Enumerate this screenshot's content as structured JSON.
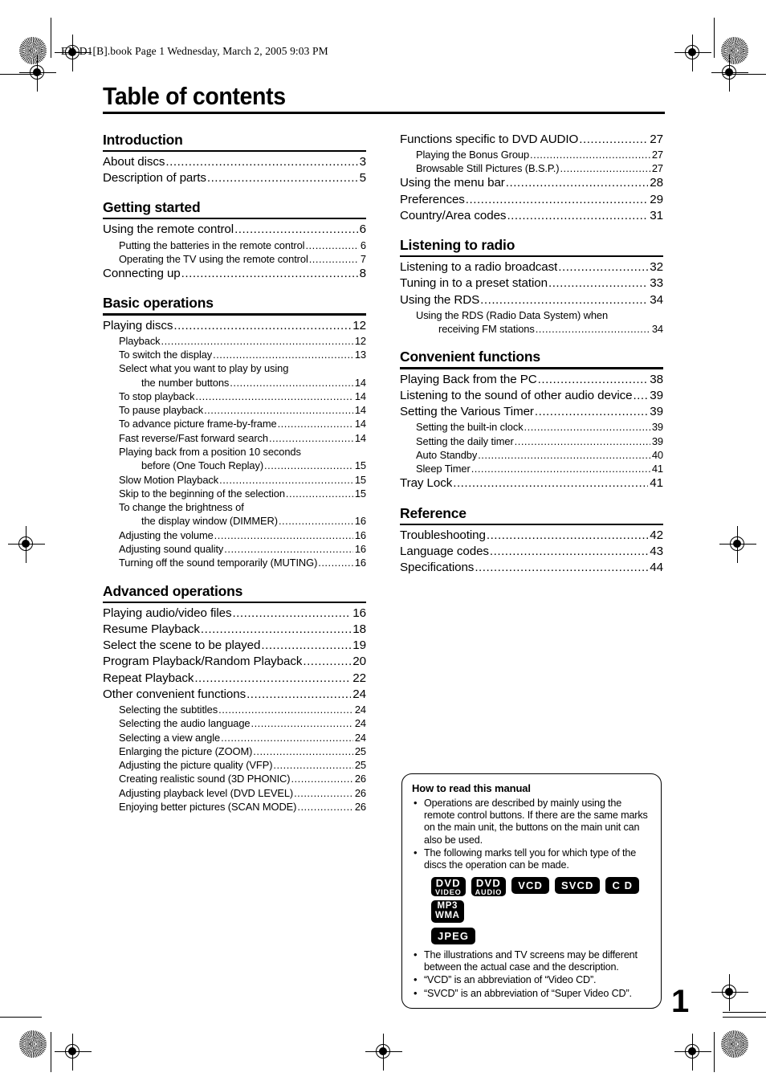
{
  "file_header": "EX-D1[B].book  Page 1  Wednesday, March 2, 2005  9:03 PM",
  "page_title": "Table of contents",
  "page_number": "1",
  "left_column": [
    {
      "heading": "Introduction",
      "entries": [
        {
          "level": 0,
          "text": "About discs",
          "page": "3"
        },
        {
          "level": 0,
          "text": "Description of parts",
          "page": "5"
        }
      ]
    },
    {
      "heading": "Getting started",
      "entries": [
        {
          "level": 0,
          "text": "Using the remote control",
          "page": "6"
        },
        {
          "level": 1,
          "text": "Putting the batteries in the remote control",
          "page": "6"
        },
        {
          "level": 1,
          "text": "Operating the TV using the remote control",
          "page": "7"
        },
        {
          "level": 0,
          "text": "Connecting up",
          "page": "8"
        }
      ]
    },
    {
      "heading": "Basic operations",
      "entries": [
        {
          "level": 0,
          "text": "Playing discs",
          "page": "12"
        },
        {
          "level": 1,
          "text": "Playback",
          "page": "12"
        },
        {
          "level": 1,
          "text": "To switch the display",
          "page": "13"
        },
        {
          "level": 1,
          "text": "Select what you want to play by using",
          "page": "",
          "cont": true
        },
        {
          "level": 2,
          "text": "the number buttons",
          "page": "14"
        },
        {
          "level": 1,
          "text": "To stop playback",
          "page": "14"
        },
        {
          "level": 1,
          "text": "To pause playback",
          "page": "14"
        },
        {
          "level": 1,
          "text": "To advance picture frame-by-frame",
          "page": "14"
        },
        {
          "level": 1,
          "text": "Fast reverse/Fast forward search",
          "page": "14"
        },
        {
          "level": 1,
          "text": "Playing back from a position 10 seconds",
          "page": "",
          "cont": true
        },
        {
          "level": 2,
          "text": "before (One Touch Replay)",
          "page": "15"
        },
        {
          "level": 1,
          "text": "Slow Motion Playback",
          "page": "15"
        },
        {
          "level": 1,
          "text": "Skip to the beginning of the selection",
          "page": "15"
        },
        {
          "level": 1,
          "text": "To change the brightness of",
          "page": "",
          "cont": true
        },
        {
          "level": 2,
          "text": "the display window (DIMMER)",
          "page": "16"
        },
        {
          "level": 1,
          "text": "Adjusting the volume",
          "page": "16"
        },
        {
          "level": 1,
          "text": "Adjusting sound quality",
          "page": "16"
        },
        {
          "level": 1,
          "text": "Turning off the sound temporarily (MUTING)",
          "page": "16"
        }
      ]
    },
    {
      "heading": "Advanced operations",
      "entries": [
        {
          "level": 0,
          "text": "Playing audio/video files",
          "page": "16"
        },
        {
          "level": 0,
          "text": "Resume Playback",
          "page": "18"
        },
        {
          "level": 0,
          "text": "Select the scene to be played",
          "page": "19"
        },
        {
          "level": 0,
          "text": "Program Playback/Random Playback",
          "page": "20"
        },
        {
          "level": 0,
          "text": "Repeat Playback",
          "page": "22"
        },
        {
          "level": 0,
          "text": "Other convenient functions",
          "page": "24"
        },
        {
          "level": 1,
          "text": "Selecting the subtitles",
          "page": "24"
        },
        {
          "level": 1,
          "text": "Selecting the audio language",
          "page": "24"
        },
        {
          "level": 1,
          "text": "Selecting a view angle",
          "page": "24"
        },
        {
          "level": 1,
          "text": "Enlarging the picture (ZOOM)",
          "page": "25"
        },
        {
          "level": 1,
          "text": "Adjusting the picture quality (VFP)",
          "page": "25"
        },
        {
          "level": 1,
          "text": "Creating realistic sound (3D PHONIC)",
          "page": "26"
        },
        {
          "level": 1,
          "text": "Adjusting playback level (DVD LEVEL)",
          "page": "26"
        },
        {
          "level": 1,
          "text": "Enjoying better pictures (SCAN MODE)",
          "page": "26"
        }
      ]
    }
  ],
  "right_column": [
    {
      "heading": "",
      "entries": [
        {
          "level": 0,
          "text": "Functions specific to DVD AUDIO",
          "page": "27"
        },
        {
          "level": 1,
          "text": "Playing the Bonus Group",
          "page": "27"
        },
        {
          "level": 1,
          "text": "Browsable Still Pictures (B.S.P.)",
          "page": "27"
        },
        {
          "level": 0,
          "text": "Using the menu bar",
          "page": "28"
        },
        {
          "level": 0,
          "text": "Preferences",
          "page": "29"
        },
        {
          "level": 0,
          "text": "Country/Area codes",
          "page": "31"
        }
      ]
    },
    {
      "heading": "Listening to radio",
      "entries": [
        {
          "level": 0,
          "text": "Listening to a radio broadcast",
          "page": "32"
        },
        {
          "level": 0,
          "text": "Tuning in to a preset station",
          "page": "33"
        },
        {
          "level": 0,
          "text": "Using the RDS",
          "page": "34"
        },
        {
          "level": 1,
          "text": "Using the RDS (Radio Data System) when",
          "page": "",
          "cont": true
        },
        {
          "level": 2,
          "text": "receiving FM stations",
          "page": "34"
        }
      ]
    },
    {
      "heading": "Convenient functions",
      "entries": [
        {
          "level": 0,
          "text": "Playing Back from the PC",
          "page": "38"
        },
        {
          "level": 0,
          "text": "Listening to the sound of other audio device",
          "page": "39"
        },
        {
          "level": 0,
          "text": "Setting the Various Timer",
          "page": "39"
        },
        {
          "level": 1,
          "text": "Setting the built-in clock",
          "page": "39"
        },
        {
          "level": 1,
          "text": "Setting the daily timer",
          "page": "39"
        },
        {
          "level": 1,
          "text": "Auto Standby",
          "page": "40"
        },
        {
          "level": 1,
          "text": "Sleep Timer",
          "page": "41"
        },
        {
          "level": 0,
          "text": "Tray Lock",
          "page": "41"
        }
      ]
    },
    {
      "heading": "Reference",
      "entries": [
        {
          "level": 0,
          "text": "Troubleshooting",
          "page": "42"
        },
        {
          "level": 0,
          "text": "Language codes",
          "page": "43"
        },
        {
          "level": 0,
          "text": "Specifications",
          "page": "44"
        }
      ]
    }
  ],
  "howto": {
    "title": "How to read this manual",
    "bullets_top": [
      "Operations are described by mainly using the remote control buttons. If there are the same marks on the main unit, the buttons on the main unit can also be used.",
      "The following marks tell you for which type of the discs the operation can be made."
    ],
    "badges": [
      {
        "line1": "DVD",
        "line2": "VIDEO",
        "style": "stack"
      },
      {
        "line1": "DVD",
        "line2": "AUDIO",
        "style": "stack"
      },
      {
        "line1": "VCD",
        "line2": "",
        "style": "single"
      },
      {
        "line1": "SVCD",
        "line2": "",
        "style": "single"
      },
      {
        "line1": "C D",
        "line2": "",
        "style": "single"
      },
      {
        "line1": "MP3",
        "line2": "WMA",
        "style": "stack2"
      }
    ],
    "badges_row2": [
      {
        "line1": "JPEG",
        "line2": "",
        "style": "single"
      }
    ],
    "bullets_bottom": [
      "The illustrations and TV screens may be different between the actual case and the description.",
      "“VCD” is an abbreviation of “Video CD”.",
      "“SVCD” is an abbreviation of “Super Video CD”."
    ]
  }
}
